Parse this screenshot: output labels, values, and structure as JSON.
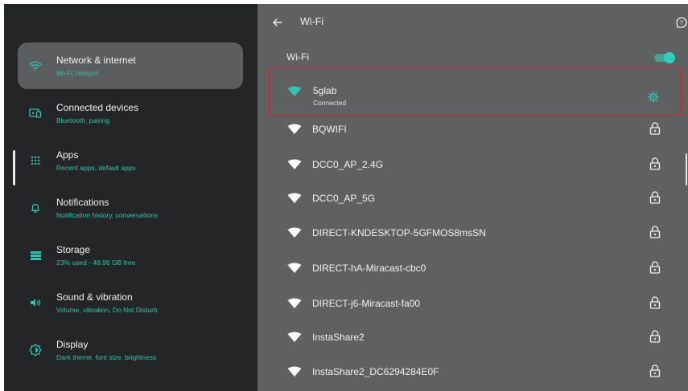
{
  "sidebar": {
    "items": [
      {
        "title": "Network & internet",
        "subtitle": "Wi-Fi, hotspot",
        "icon": "wifi-icon",
        "selected": true
      },
      {
        "title": "Connected devices",
        "subtitle": "Bluetooth, pairing",
        "icon": "devices-icon"
      },
      {
        "title": "Apps",
        "subtitle": "Recent apps, default apps",
        "icon": "apps-grid-icon"
      },
      {
        "title": "Notifications",
        "subtitle": "Notification history, conversations",
        "icon": "bell-icon"
      },
      {
        "title": "Storage",
        "subtitle": "23% used - 48.96 GB free",
        "icon": "storage-icon"
      },
      {
        "title": "Sound & vibration",
        "subtitle": "Volume, vibration, Do Not Disturb",
        "icon": "speaker-icon"
      },
      {
        "title": "Display",
        "subtitle": "Dark theme, font size, brightness",
        "icon": "display-brightness-icon"
      }
    ]
  },
  "header": {
    "title": "Wi-Fi",
    "back_icon": "arrow-back-icon",
    "help_icon": "help-icon"
  },
  "wifi": {
    "toggle_label": "Wi-Fi",
    "enabled": true,
    "connected": {
      "name": "5glab",
      "status": "Connected",
      "icon": "wifi-icon",
      "settings_icon": "gear-icon"
    },
    "networks": [
      {
        "name": "BQWIFI",
        "locked": true
      },
      {
        "name": "DCC0_AP_2.4G",
        "locked": true
      },
      {
        "name": "DCC0_AP_5G",
        "locked": true
      },
      {
        "name": "DIRECT-KNDESKTOP-5GFMOS8msSN",
        "locked": true
      },
      {
        "name": "DIRECT-hA-Miracast-cbc0",
        "locked": true
      },
      {
        "name": "DIRECT-j6-Miracast-fa00",
        "locked": true
      },
      {
        "name": "InstaShare2",
        "locked": true
      },
      {
        "name": "InstaShare2_DC6294284E0F",
        "locked": true
      }
    ]
  },
  "colors": {
    "accent": "#2ec4b0",
    "sidebar_bg": "#242526",
    "content_bg": "#5f6061",
    "selected_item_bg": "#5c5d5e",
    "highlight_border": "#c52b2b"
  }
}
